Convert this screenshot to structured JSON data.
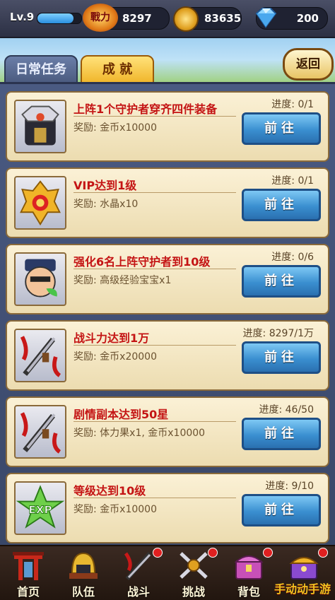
{
  "header": {
    "level": "Lv.9",
    "xp_fraction": 0.82,
    "power_label": "戰力",
    "power_value": "8297",
    "gold": "83635",
    "gems": "200"
  },
  "tabs": [
    {
      "label": "日常任务",
      "active": false
    },
    {
      "label": "成 就",
      "active": true
    }
  ],
  "back_label": "返回",
  "reward_prefix": "奖励:",
  "progress_prefix": "进度:",
  "go_label": "前往",
  "achievements": [
    {
      "title": "上阵1个守护者穿齐四件装备",
      "reward": "金币x10000",
      "progress": "0/1",
      "icon": "armor-icon"
    },
    {
      "title": "VIP达到1级",
      "reward": "水晶x10",
      "progress": "0/1",
      "icon": "vip-crest-icon"
    },
    {
      "title": "强化6名上阵守护者到10级",
      "reward": "高级经验宝宝x1",
      "progress": "0/6",
      "icon": "guardian-head-icon"
    },
    {
      "title": "战斗力达到1万",
      "reward": "金币x20000",
      "progress": "8297/1万",
      "icon": "swords-icon"
    },
    {
      "title": "剧情副本达到50星",
      "reward": "体力果x1, 金币x10000",
      "progress": "46/50",
      "icon": "swords-icon"
    },
    {
      "title": "等级达到10级",
      "reward": "金币x10000",
      "progress": "9/10",
      "icon": "exp-star-icon"
    }
  ],
  "nav": [
    {
      "label": "首页",
      "icon": "gate-icon"
    },
    {
      "label": "队伍",
      "icon": "helmet-icon"
    },
    {
      "label": "战斗",
      "icon": "battle-axe-icon"
    },
    {
      "label": "挑战",
      "icon": "crossed-swords-icon"
    },
    {
      "label": "背包",
      "icon": "chest-icon"
    },
    {
      "label": "",
      "icon": "treasure-icon"
    }
  ],
  "watermark": "手动动手游"
}
